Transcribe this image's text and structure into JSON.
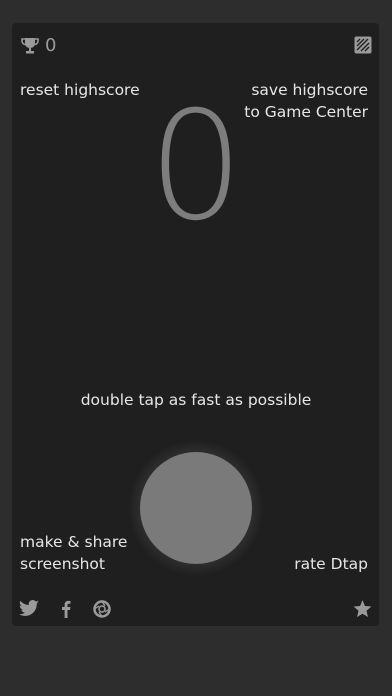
{
  "header": {
    "trophy_icon": "trophy-icon",
    "highscore_value": "0",
    "gamecenter_icon": "game-center-icon"
  },
  "actions": {
    "reset_label": "reset highscore",
    "save_label": "save highscore\nto Game Center"
  },
  "game": {
    "score": "0",
    "instruction": "double tap as fast as possible"
  },
  "bottom": {
    "share_label": "make & share\nscreenshot",
    "rate_label": "rate Dtap"
  },
  "footer": {
    "icons": [
      "twitter-icon",
      "facebook-icon",
      "camera-icon",
      "star-icon"
    ]
  },
  "colors": {
    "background": "#2d2d2d",
    "card": "#1f1f1f",
    "text": "#e6e6e6",
    "score": "#7d7d7d",
    "button": "#7a7a7a",
    "icon": "#9a9a9a"
  }
}
